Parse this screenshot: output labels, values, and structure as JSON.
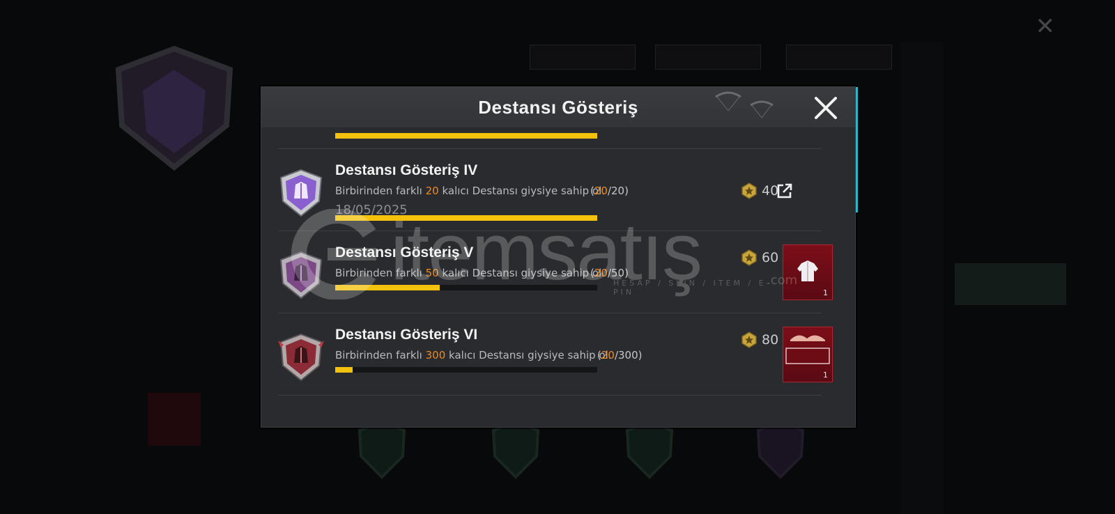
{
  "modal": {
    "title": "Destansı Gösteriş",
    "close_icon": "close-x-icon"
  },
  "achievements": [
    {
      "name": "Destansı Gösteriş IV",
      "desc_before": "Birbirinden farklı ",
      "desc_num": "20",
      "desc_after": " kalıcı Destansı giysiye sahip ol.",
      "prog_open": "(",
      "prog_cur": "20",
      "prog_total": "/20)",
      "date": "18/05/2025",
      "progress_fraction": 1.0,
      "points": "40",
      "emblem_color": "#8a5fd0",
      "action_icon": "share-external-icon"
    },
    {
      "name": "Destansı Gösteriş V",
      "desc_before": "Birbirinden farklı ",
      "desc_num": "50",
      "desc_after": " kalıcı Destansı giysiye sahip ol.",
      "prog_open": "(",
      "prog_cur": "20",
      "prog_total": "/50)",
      "progress_fraction": 0.4,
      "points": "60",
      "emblem_color": "#7b4a86",
      "reward_qty": "1",
      "reward_icon": "outfit-jacket-icon"
    },
    {
      "name": "Destansı Gösteriş VI",
      "desc_before": "Birbirinden farklı ",
      "desc_num": "300",
      "desc_after": " kalıcı Destansı giysiye sahip ol.",
      "prog_open": "(",
      "prog_cur": "20",
      "prog_total": "/300)",
      "progress_fraction": 0.0667,
      "points": "80",
      "emblem_color": "#8a2b35",
      "reward_qty": "1",
      "reward_icon": "name-plate-icon"
    }
  ],
  "watermark": {
    "text": "itemsatış",
    "sub": "HESAP / SKIN / ITEM / E-PIN",
    "domain": ".com"
  },
  "colors": {
    "progress": "#f4c20d",
    "highlight": "#f18a1f",
    "accent": "#2bb6c8"
  }
}
